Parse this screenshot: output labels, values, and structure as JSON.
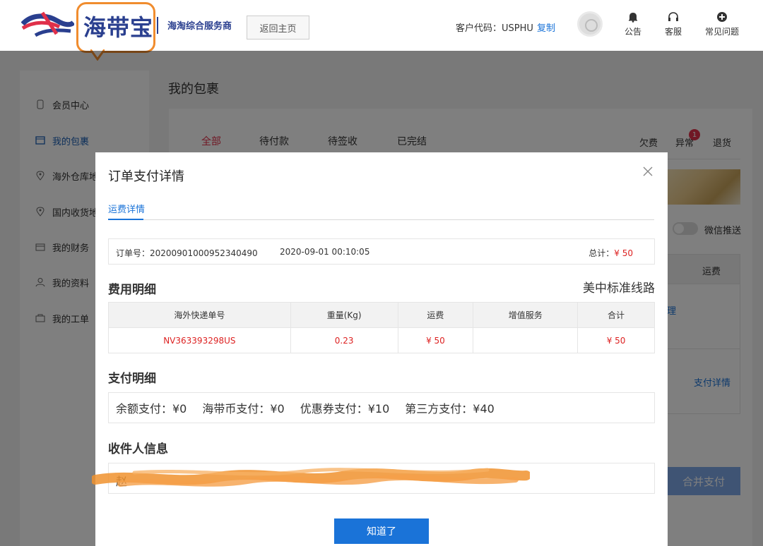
{
  "header": {
    "logo_text": "海带宝",
    "logo_sub": "海淘综合服务商",
    "back_label": "返回主页",
    "customer_code_label": "客户代码：USPHU",
    "copy_label": "复制",
    "items": [
      {
        "label": "公告",
        "icon": "bell-icon"
      },
      {
        "label": "客服",
        "icon": "headset-icon"
      },
      {
        "label": "常见问题",
        "icon": "help-icon"
      }
    ]
  },
  "sidebar": {
    "items": [
      {
        "label": "会员中心",
        "icon": "member-icon"
      },
      {
        "label": "我的包裹",
        "icon": "package-icon"
      },
      {
        "label": "海外仓库地",
        "icon": "location-icon"
      },
      {
        "label": "国内收货地",
        "icon": "location-icon"
      },
      {
        "label": "我的财务",
        "icon": "wallet-icon"
      },
      {
        "label": "我的资料",
        "icon": "user-icon"
      },
      {
        "label": "我的工单",
        "icon": "ticket-icon"
      }
    ]
  },
  "main": {
    "title": "我的包裹",
    "tabs": [
      "全部",
      "待付款",
      "待签收",
      "已完结"
    ],
    "right_tabs": [
      "欠费",
      "异常",
      "退货"
    ],
    "exception_badge": "1",
    "toggle_label": "微信推送",
    "table_header_fee": "运费",
    "row_link": "支付详情",
    "row_link_partial": "理",
    "merge_btn": "合并支付"
  },
  "modal": {
    "title": "订单支付详情",
    "tab": "运费详情",
    "order_no": "订单号：20200901000952340490",
    "order_date": "2020-09-01 00:10:05",
    "total_label": "总计：",
    "total_value": "¥ 50",
    "fee_section": "费用明细",
    "route": "美中标准线路",
    "fee_headers": [
      "海外快递单号",
      "重量(Kg)",
      "运费",
      "增值服务",
      "合计"
    ],
    "fee_row": [
      "NV363393298US",
      "0.23",
      "¥ 50",
      "",
      "¥ 50"
    ],
    "pay_section": "支付明细",
    "payments": [
      "余额支付：¥0",
      "海带币支付：¥0",
      "优惠券支付：¥10",
      "第三方支付：¥40"
    ],
    "recv_section": "收件人信息",
    "recv_name": "赵",
    "ok_label": "知道了"
  }
}
